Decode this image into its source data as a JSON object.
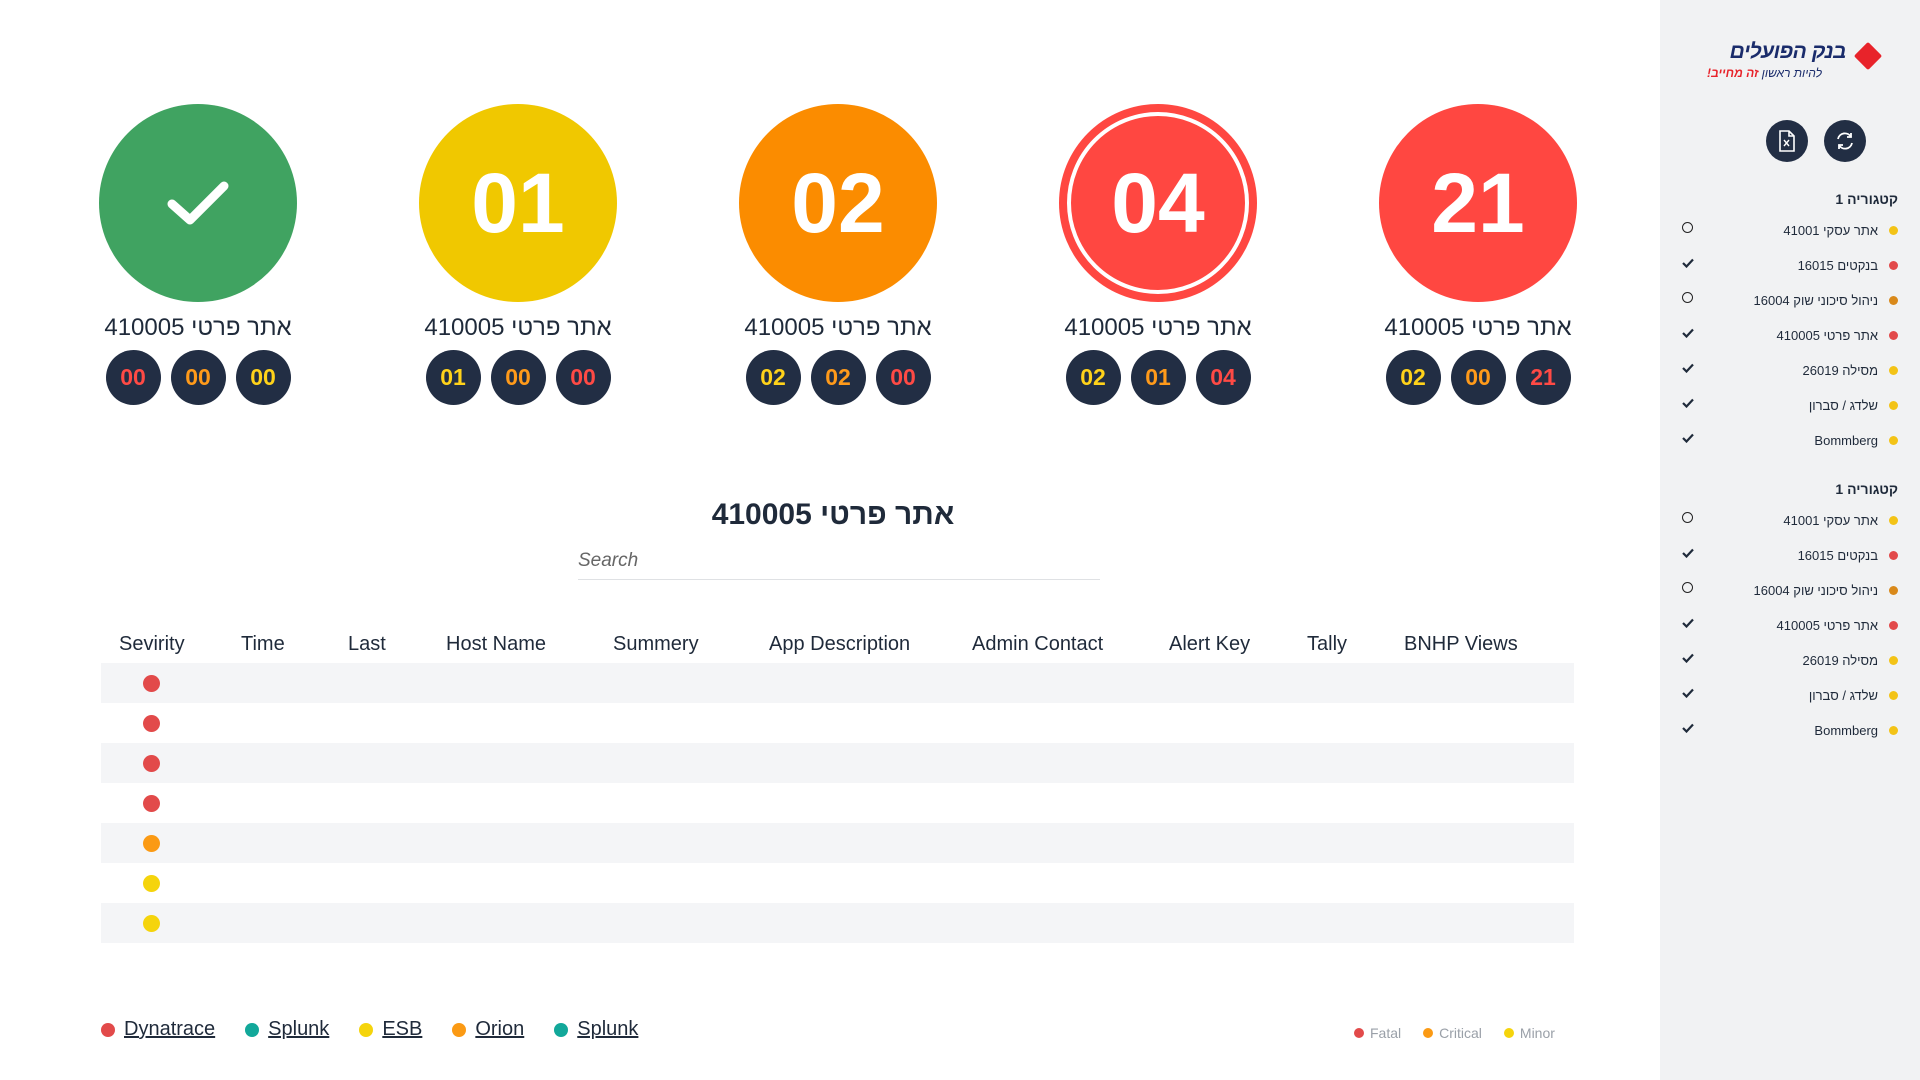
{
  "sidebar": {
    "logo": {
      "name": "בנק הפועלים",
      "tagline_a": "להיות ראשון",
      "tagline_b": "זה מחייב!"
    },
    "tools": [
      {
        "icon": "excel-file-icon"
      },
      {
        "icon": "refresh-icon"
      }
    ],
    "categories": [
      {
        "title": "קטגוריה 1",
        "items": [
          {
            "label": "אתר עסקי 41001",
            "dot": "#f3c316",
            "mark": "circle"
          },
          {
            "label": "בנקטים 16015",
            "dot": "#e24a4a",
            "mark": "check"
          },
          {
            "label": "ניהול סיכוני שוק 16004",
            "dot": "#d9891a",
            "mark": "circle"
          },
          {
            "label": "אתר פרטי 410005",
            "dot": "#e24a4a",
            "mark": "check"
          },
          {
            "label": "מסילה 26019",
            "dot": "#f3c316",
            "mark": "check"
          },
          {
            "label": "שלדג / סברון",
            "dot": "#f3c316",
            "mark": "check"
          },
          {
            "label": "Bommberg",
            "dot": "#f3c316",
            "mark": "check"
          }
        ]
      },
      {
        "title": "קטגוריה 1",
        "items": [
          {
            "label": "אתר עסקי 41001",
            "dot": "#f3c316",
            "mark": "circle"
          },
          {
            "label": "בנקטים 16015",
            "dot": "#e24a4a",
            "mark": "check"
          },
          {
            "label": "ניהול סיכוני שוק 16004",
            "dot": "#d9891a",
            "mark": "circle"
          },
          {
            "label": "אתר פרטי 410005",
            "dot": "#e24a4a",
            "mark": "check"
          },
          {
            "label": "מסילה 26019",
            "dot": "#f3c316",
            "mark": "check"
          },
          {
            "label": "שלדג / סברון",
            "dot": "#f3c316",
            "mark": "check"
          },
          {
            "label": "Bommberg",
            "dot": "#f3c316",
            "mark": "check"
          }
        ]
      }
    ]
  },
  "colors": {
    "green": "#40a361",
    "yellow": "#f0c800",
    "orange": "#fb8c00",
    "red": "#ff4741",
    "mini_bg": "#222e44",
    "mini_red": "#ff4a45",
    "mini_orange": "#ff9a1a",
    "mini_yellow": "#ffd21a"
  },
  "cards": [
    {
      "title": "אתר פרטי 410005",
      "value": "",
      "icon": "checkmark-icon",
      "color": "#40a361",
      "ring": false,
      "counts": [
        {
          "v": "00",
          "c": "#ff4a45"
        },
        {
          "v": "00",
          "c": "#ff9a1a"
        },
        {
          "v": "00",
          "c": "#ffd21a"
        }
      ]
    },
    {
      "title": "אתר פרטי 410005",
      "value": "01",
      "color": "#f0c800",
      "ring": false,
      "counts": [
        {
          "v": "01",
          "c": "#ffd21a"
        },
        {
          "v": "00",
          "c": "#ff9a1a"
        },
        {
          "v": "00",
          "c": "#ff4a45"
        }
      ]
    },
    {
      "title": "אתר פרטי 410005",
      "value": "02",
      "color": "#fb8c00",
      "ring": false,
      "counts": [
        {
          "v": "02",
          "c": "#ffd21a"
        },
        {
          "v": "02",
          "c": "#ff9a1a"
        },
        {
          "v": "00",
          "c": "#ff4a45"
        }
      ]
    },
    {
      "title": "אתר פרטי 410005",
      "value": "04",
      "color": "#ff4741",
      "ring": true,
      "counts": [
        {
          "v": "02",
          "c": "#ffd21a"
        },
        {
          "v": "01",
          "c": "#ff9a1a"
        },
        {
          "v": "04",
          "c": "#ff4a45"
        }
      ]
    },
    {
      "title": "אתר פרטי 410005",
      "value": "21",
      "color": "#ff4741",
      "ring": false,
      "counts": [
        {
          "v": "02",
          "c": "#ffd21a"
        },
        {
          "v": "00",
          "c": "#ff9a1a"
        },
        {
          "v": "21",
          "c": "#ff4a45"
        }
      ]
    }
  ],
  "main": {
    "title": "אתר פרטי 410005",
    "search_placeholder": "Search"
  },
  "table": {
    "columns": [
      "Sevirity",
      "Time",
      "Last",
      "Host Name",
      "Summery",
      "App Description",
      "Admin Contact",
      "Alert Key",
      "Tally",
      "BNHP Views"
    ],
    "rows": [
      {
        "severity": "#e24a4a"
      },
      {
        "severity": "#e24a4a"
      },
      {
        "severity": "#e24a4a"
      },
      {
        "severity": "#e24a4a"
      },
      {
        "severity": "#fb9a14"
      },
      {
        "severity": "#f5d40c"
      },
      {
        "severity": "#f5d40c"
      }
    ]
  },
  "sources": [
    {
      "label": "Dynatrace",
      "color": "#e24a4a"
    },
    {
      "label": "Splunk",
      "color": "#12a89a"
    },
    {
      "label": "ESB",
      "color": "#f5d40c"
    },
    {
      "label": "Orion",
      "color": "#fb9a14"
    },
    {
      "label": "Splunk",
      "color": "#12a89a"
    }
  ],
  "severity_legend": [
    {
      "label": "Fatal",
      "color": "#e24a4a"
    },
    {
      "label": "Critical",
      "color": "#fb9a14"
    },
    {
      "label": "Minor",
      "color": "#f5d40c"
    }
  ]
}
